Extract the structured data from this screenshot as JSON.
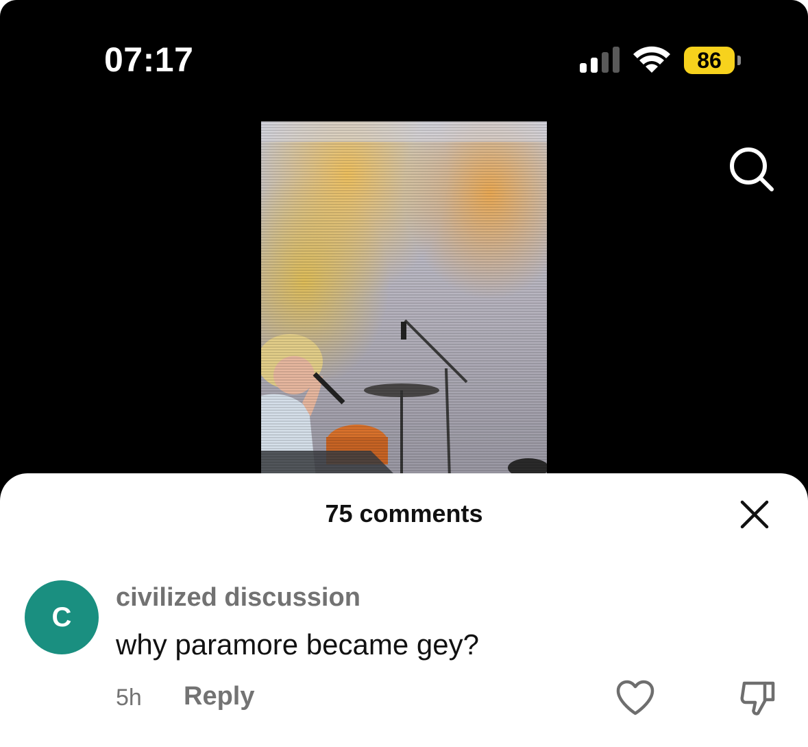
{
  "status_bar": {
    "time": "07:17",
    "battery_level": "86",
    "battery_fraction": 0.86,
    "signal_icon": "cellular-signal-icon",
    "wifi_icon": "wifi-icon",
    "battery_color": "#f7d21d"
  },
  "video": {
    "icon": "video-thumbnail-image"
  },
  "search": {
    "icon": "search-icon"
  },
  "comments_sheet": {
    "title": "75 comments",
    "close_icon": "close-icon",
    "comments": [
      {
        "avatar_letter": "C",
        "avatar_color": "#1a8f80",
        "username": "civilized discussion",
        "text": "why paramore became gey?",
        "time": "5h",
        "reply_label": "Reply",
        "like_icon": "heart-icon",
        "dislike_icon": "thumbs-down-icon"
      }
    ]
  }
}
